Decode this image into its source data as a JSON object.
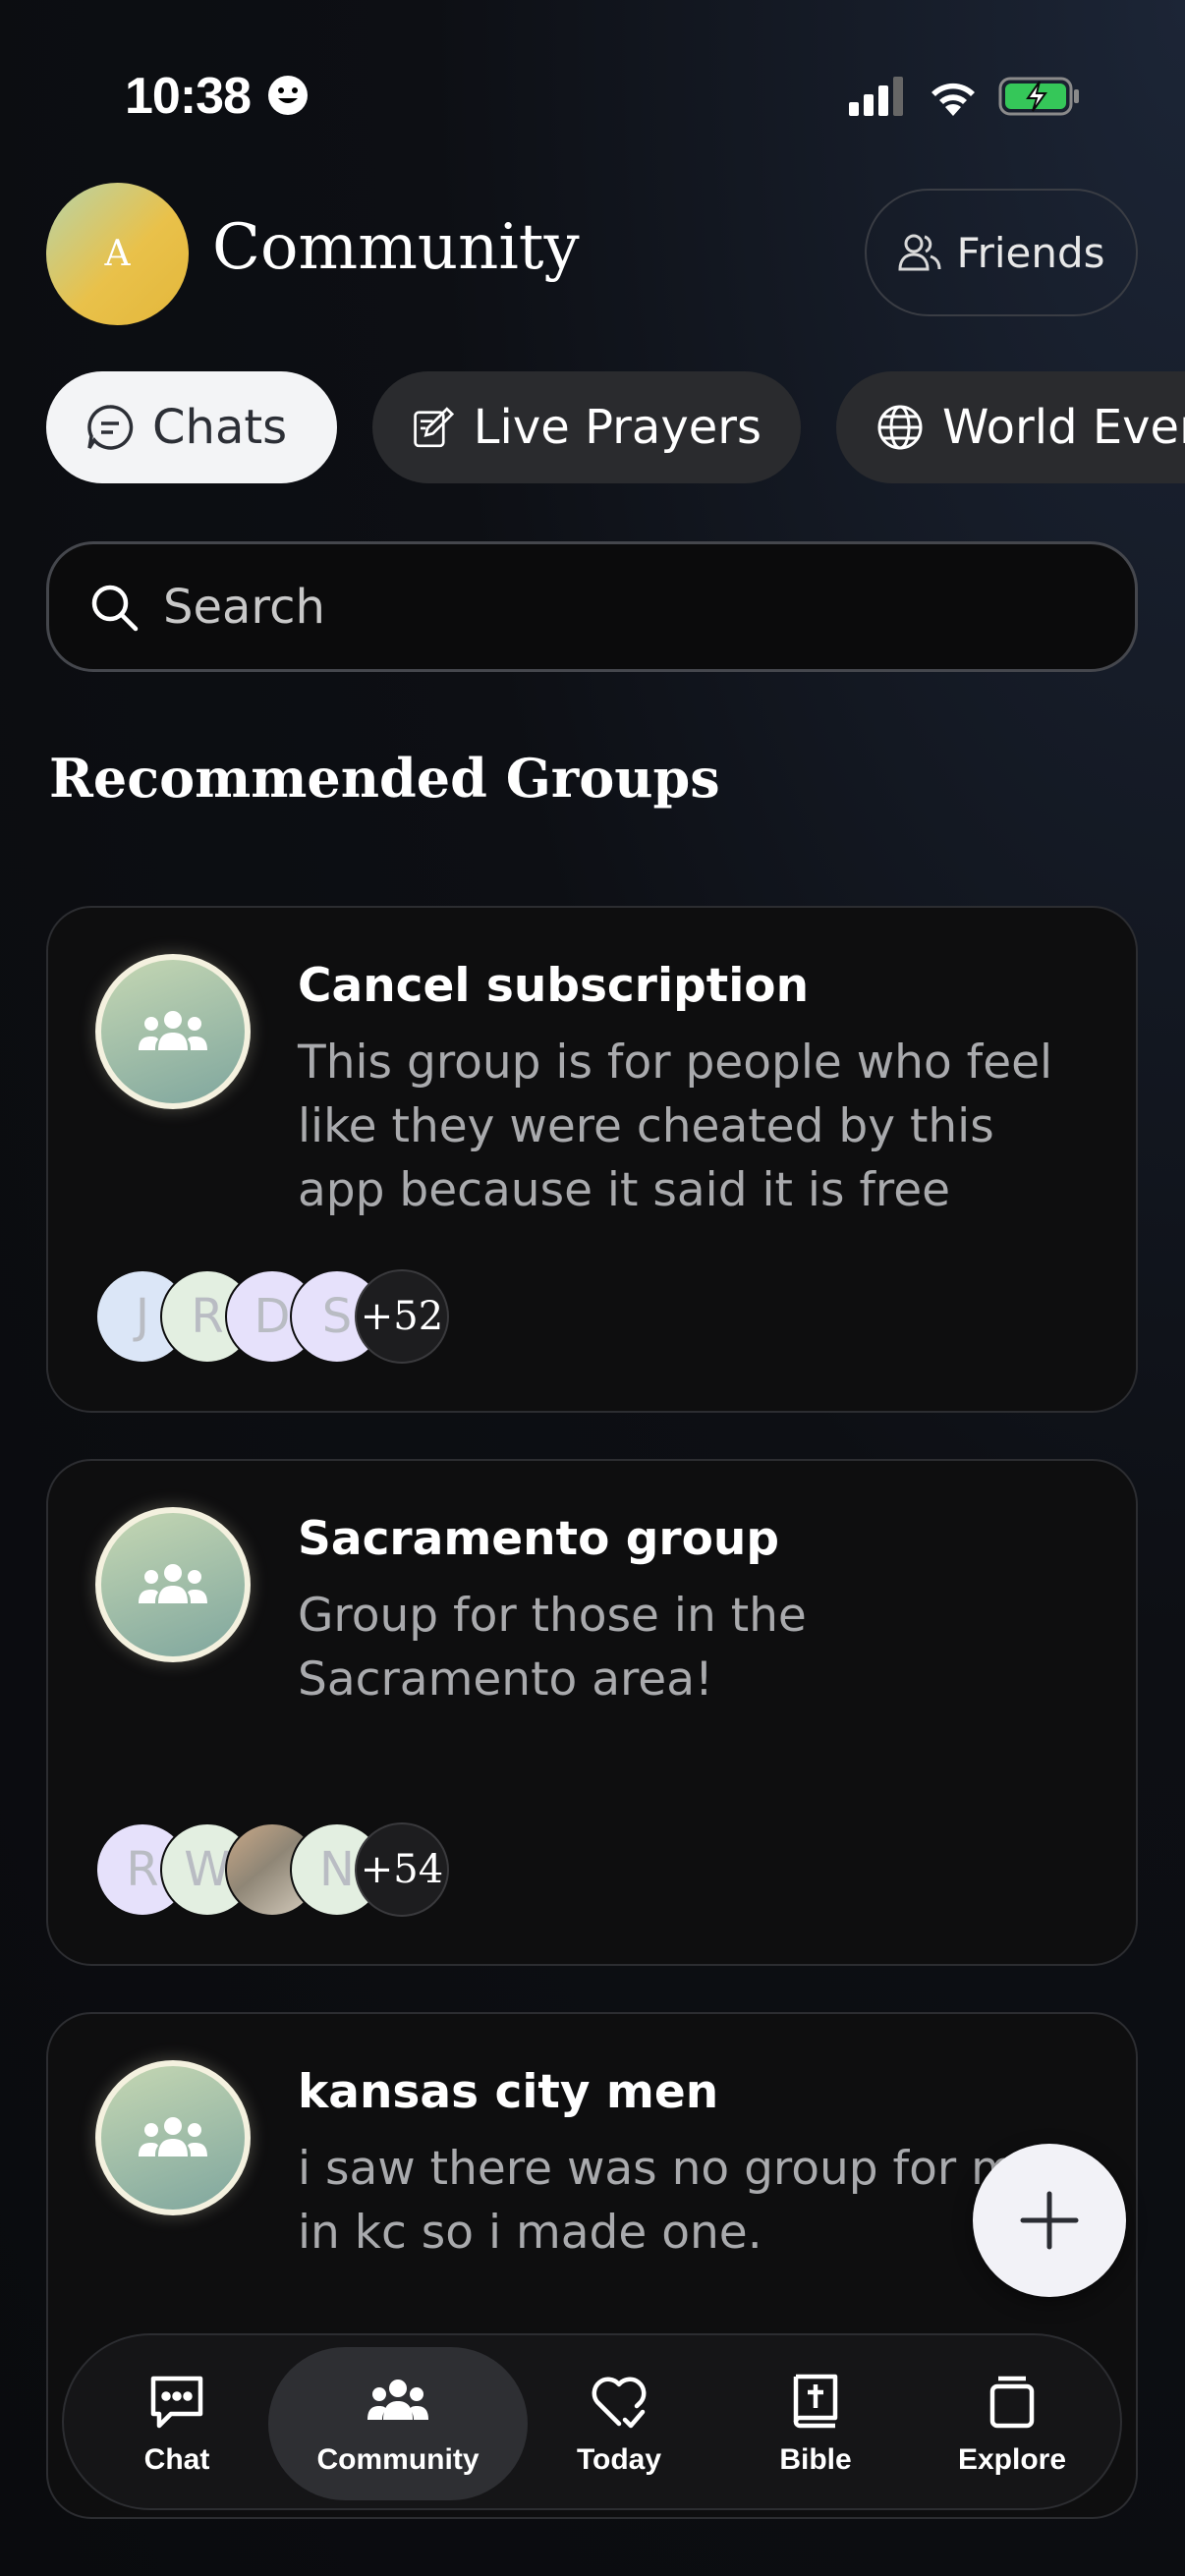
{
  "status_bar": {
    "time": "10:38"
  },
  "header": {
    "avatar_initial": "A",
    "title": "Community",
    "friends_label": "Friends"
  },
  "tabs": [
    {
      "label": "Chats",
      "icon": "chat-bubble-icon",
      "active": true
    },
    {
      "label": "Live Prayers",
      "icon": "pencil-square-icon",
      "active": false
    },
    {
      "label": "World Events",
      "icon": "globe-icon",
      "active": false
    }
  ],
  "search": {
    "placeholder": "Search"
  },
  "section_title": "Recommended Groups",
  "groups": [
    {
      "title": "Cancel subscription",
      "description": "This group is for people who feel like they were cheated by this app because it said it is free",
      "members": [
        "J",
        "R",
        "D",
        "S"
      ],
      "more_count": "+52"
    },
    {
      "title": "Sacramento group",
      "description": "Group for those in the Sacramento area!",
      "members": [
        "R",
        "W",
        "",
        "N"
      ],
      "more_count": "+54"
    },
    {
      "title": "kansas city men",
      "description": "i saw there was no group for men in kc so i made one."
    }
  ],
  "bottom_nav": [
    {
      "label": "Chat",
      "icon": "chat-dots-icon",
      "active": false
    },
    {
      "label": "Community",
      "icon": "people-icon",
      "active": true
    },
    {
      "label": "Today",
      "icon": "heart-check-icon",
      "active": false
    },
    {
      "label": "Bible",
      "icon": "bible-icon",
      "active": false
    },
    {
      "label": "Explore",
      "icon": "cards-icon",
      "active": false
    }
  ]
}
